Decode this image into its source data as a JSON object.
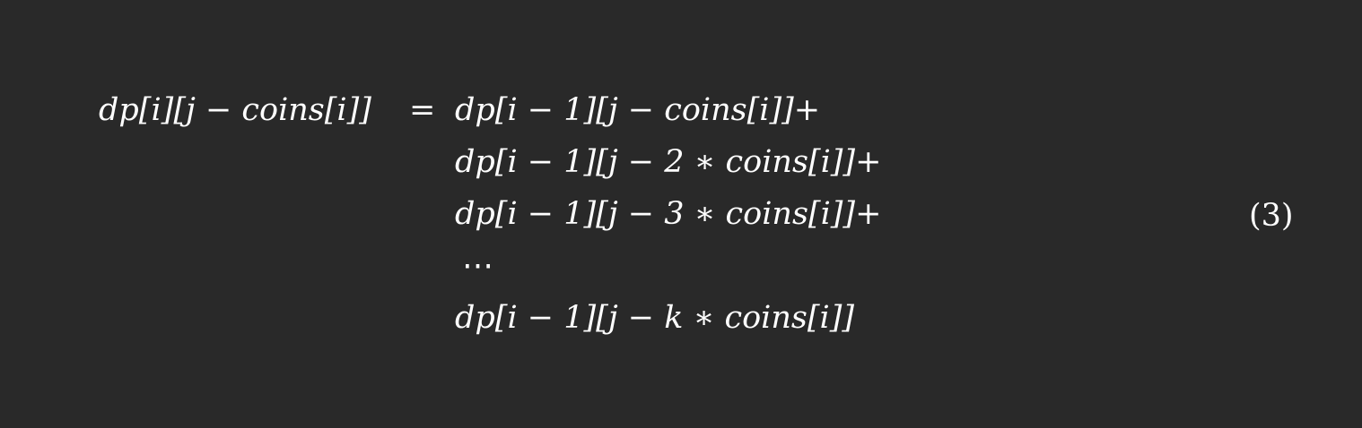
{
  "equation": {
    "lhs": "dp[i][j − coins[i]]",
    "equals": "=",
    "rhs_lines": [
      "dp[i − 1][j − coins[i]]+",
      "dp[i − 1][j − 2 ∗ coins[i]]+",
      "dp[i − 1][j − 3 ∗ coins[i]]+",
      "⋯",
      "dp[i − 1][j − k ∗ coins[i]]"
    ],
    "number": "(3)"
  }
}
